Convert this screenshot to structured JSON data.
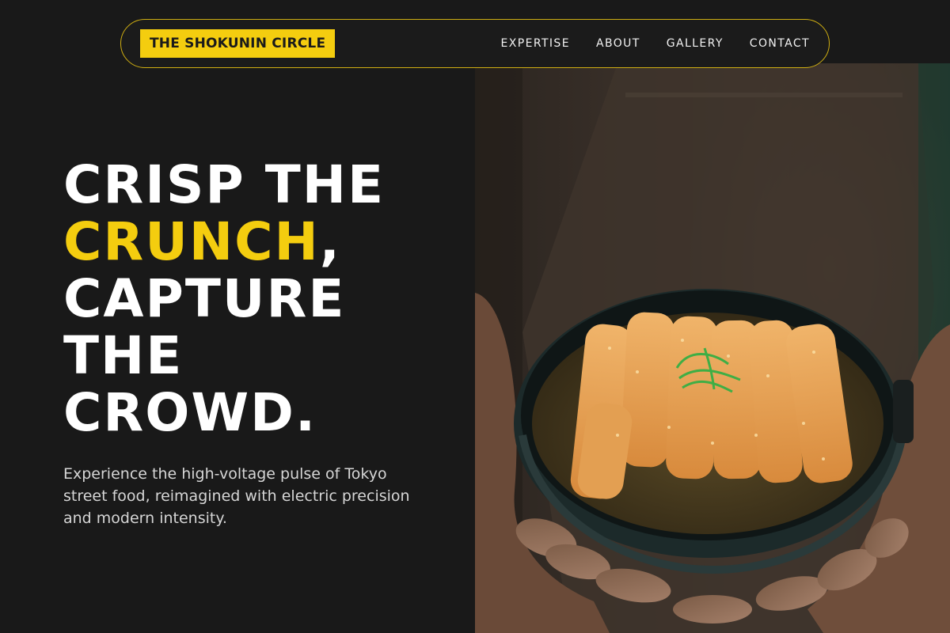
{
  "brand": {
    "name": "THE SHOKUNIN CIRCLE"
  },
  "nav": {
    "items": [
      {
        "label": "EXPERTISE"
      },
      {
        "label": "ABOUT"
      },
      {
        "label": "GALLERY"
      },
      {
        "label": "CONTACT"
      }
    ]
  },
  "hero": {
    "line1": "CRISP THE",
    "accent": "CRUNCH",
    "comma": ",",
    "line2": "CAPTURE",
    "line3": "THE",
    "line4": "CROWD.",
    "subtitle": "Experience the high-voltage pulse of Tokyo street food, reimagined with electric precision and modern intensity."
  },
  "colors": {
    "background": "#191919",
    "accent": "#f4cd0f",
    "text": "#ffffff",
    "muted_text": "#d6d6d6"
  }
}
